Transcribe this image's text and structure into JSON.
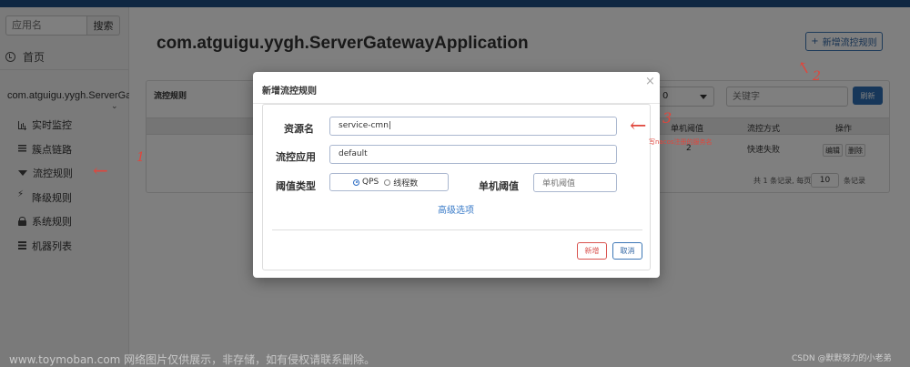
{
  "sidebar": {
    "search_placeholder": "应用名",
    "search_button": "搜索",
    "home_label": "首页",
    "app_name": "com.atguigu.yygh.ServerGat",
    "menu": [
      {
        "label": "实时监控",
        "icon": "bar-chart-icon"
      },
      {
        "label": "簇点链路",
        "icon": "list-icon"
      },
      {
        "label": "流控规则",
        "icon": "filter-icon"
      },
      {
        "label": "降级规则",
        "icon": "bolt-icon"
      },
      {
        "label": "系统规则",
        "icon": "lock-icon"
      },
      {
        "label": "机器列表",
        "icon": "grid-icon"
      }
    ]
  },
  "main": {
    "title": "com.atguigu.yygh.ServerGatewayApplication",
    "add_rule_button": "新增流控规则",
    "panel_title": "流控规则",
    "select_value": "0",
    "keyword_placeholder": "关键字",
    "refresh_button": "刷新",
    "table": {
      "headers": {
        "threshold": "单机阈值",
        "mode": "流控方式",
        "action": "操作"
      },
      "row": {
        "threshold": "2",
        "mode": "快速失败",
        "edit": "编辑",
        "delete": "删除"
      }
    },
    "pager": {
      "text_before": "共 1 条记录, 每页",
      "page_size": "10",
      "text_after": "条记录"
    }
  },
  "modal": {
    "title": "新增流控规则",
    "close": "×",
    "fields": {
      "resource_label": "资源名",
      "resource_value": "service-cmn",
      "app_label": "流控应用",
      "app_value": "default",
      "type_label": "阈值类型",
      "type_options": [
        "QPS",
        "线程数"
      ],
      "type_selected": "QPS",
      "threshold_label": "单机阈值",
      "threshold_placeholder": "单机阈值"
    },
    "advanced_link": "高级选项",
    "add_button": "新增",
    "cancel_button": "取消"
  },
  "annotations": {
    "arrow": "←",
    "num1": "1",
    "num2": "2",
    "num3": "3",
    "note": "写nacos注册的服务名",
    "color": "#e0463c"
  },
  "watermark": "www.toymoban.com 网络图片仅供展示，非存储，如有侵权请联系删除。",
  "csdn": "CSDN @默默努力的小老弟"
}
